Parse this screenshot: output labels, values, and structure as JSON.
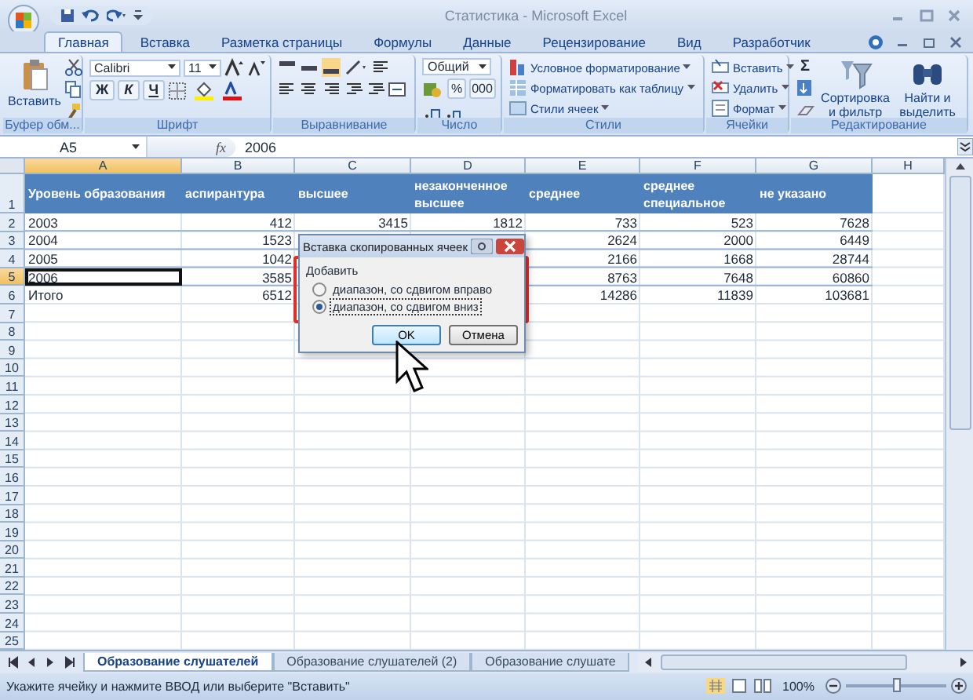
{
  "window": {
    "title": "Статистика - Microsoft Excel"
  },
  "ribbon_tabs": [
    {
      "label": "Главная",
      "selected": true
    },
    {
      "label": "Вставка",
      "selected": false
    },
    {
      "label": "Разметка страницы",
      "selected": false
    },
    {
      "label": "Формулы",
      "selected": false
    },
    {
      "label": "Данные",
      "selected": false
    },
    {
      "label": "Рецензирование",
      "selected": false
    },
    {
      "label": "Вид",
      "selected": false
    },
    {
      "label": "Разработчик",
      "selected": false
    }
  ],
  "clipboard": {
    "paste": "Вставить",
    "label": "Буфер обм..."
  },
  "font": {
    "name": "Calibri",
    "size": "11",
    "bold": "Ж",
    "italic": "К",
    "underline": "Ч",
    "label": "Шрифт"
  },
  "alignment": {
    "label": "Выравнивание"
  },
  "number": {
    "format": "Общий",
    "percent": "%",
    "thousands": "000",
    "label": "Число"
  },
  "styles": {
    "items": [
      "Условное форматирование",
      "Форматировать как таблицу",
      "Стили ячеек"
    ],
    "label": "Стили"
  },
  "cells": {
    "items": [
      "Вставить",
      "Удалить",
      "Формат"
    ],
    "label": "Ячейки"
  },
  "editing": {
    "sum": "Σ",
    "sort": "Сортировка и фильтр",
    "find": "Найти и выделить",
    "label": "Редактирование"
  },
  "formula_bar": {
    "name_box": "A5",
    "fx": "fx",
    "value": "2006"
  },
  "sheet": {
    "columns": [
      {
        "label": "A",
        "selected": true
      },
      {
        "label": "B",
        "selected": false
      },
      {
        "label": "C",
        "selected": false
      },
      {
        "label": "D",
        "selected": false
      },
      {
        "label": "E",
        "selected": false
      },
      {
        "label": "F",
        "selected": false
      },
      {
        "label": "G",
        "selected": false
      },
      {
        "label": "H",
        "selected": false
      }
    ],
    "rows": [
      {
        "number": "1",
        "kind": "header",
        "selected": false,
        "cells": {
          "A": "Уровень образования",
          "B": "аспирантура",
          "C": "высшее",
          "D": "незаконченное высшее",
          "E": "среднее",
          "F": "среднее специальное",
          "G": "не указано"
        }
      },
      {
        "number": "2",
        "kind": "table",
        "selected": false,
        "cells": {
          "A": "2003",
          "B": "412",
          "C": "3415",
          "D": "1812",
          "E": "733",
          "F": "523",
          "G": "7628"
        }
      },
      {
        "number": "3",
        "kind": "table",
        "selected": false,
        "cells": {
          "A": "2004",
          "B": "1523",
          "E": "2624",
          "F": "2000",
          "G": "6449"
        }
      },
      {
        "number": "4",
        "kind": "table",
        "selected": false,
        "cells": {
          "A": "2005",
          "B": "1042",
          "E": "2166",
          "F": "1668",
          "G": "28744"
        }
      },
      {
        "number": "5",
        "kind": "table",
        "selected": true,
        "cells": {
          "A": "2006",
          "B": "3585",
          "E": "8763",
          "F": "7648",
          "G": "60860"
        }
      },
      {
        "number": "6",
        "kind": "plain",
        "selected": false,
        "cells": {
          "A": "Итого",
          "B": "6512",
          "E": "14286",
          "F": "11839",
          "G": "103681"
        }
      },
      {
        "number": "7",
        "kind": "plain",
        "selected": false
      },
      {
        "number": "8",
        "kind": "plain",
        "selected": false
      },
      {
        "number": "9",
        "kind": "plain",
        "selected": false
      },
      {
        "number": "10",
        "kind": "plain",
        "selected": false
      },
      {
        "number": "11",
        "kind": "plain",
        "selected": false
      },
      {
        "number": "12",
        "kind": "plain",
        "selected": false
      },
      {
        "number": "13",
        "kind": "plain",
        "selected": false
      },
      {
        "number": "14",
        "kind": "plain",
        "selected": false
      },
      {
        "number": "15",
        "kind": "plain",
        "selected": false
      },
      {
        "number": "16",
        "kind": "plain",
        "selected": false
      },
      {
        "number": "17",
        "kind": "plain",
        "selected": false
      },
      {
        "number": "18",
        "kind": "plain",
        "selected": false
      },
      {
        "number": "19",
        "kind": "plain",
        "selected": false
      },
      {
        "number": "20",
        "kind": "plain",
        "selected": false
      },
      {
        "number": "21",
        "kind": "plain",
        "selected": false
      },
      {
        "number": "22",
        "kind": "plain",
        "selected": false
      },
      {
        "number": "23",
        "kind": "plain",
        "selected": false
      },
      {
        "number": "24",
        "kind": "plain",
        "selected": false
      },
      {
        "number": "25",
        "kind": "plain",
        "selected": false
      }
    ]
  },
  "dialog": {
    "title": "Вставка скопированных ячеек",
    "group": "Добавить",
    "options": [
      {
        "label": "диапазон, со сдвигом вправо",
        "selected": false
      },
      {
        "label": "диапазон, со сдвигом вниз",
        "selected": true
      }
    ],
    "buttons": [
      "OK",
      "Отмена"
    ]
  },
  "sheet_tabs": [
    {
      "label": "Образование слушателей",
      "selected": true
    },
    {
      "label": "Образование слушателей (2)",
      "selected": false
    },
    {
      "label": "Образование слушате",
      "selected": false
    }
  ],
  "status_bar": {
    "message": "Укажите ячейку и нажмите ВВОД или выберите \"Вставить\"",
    "zoom": "100%",
    "level": 0.5
  }
}
